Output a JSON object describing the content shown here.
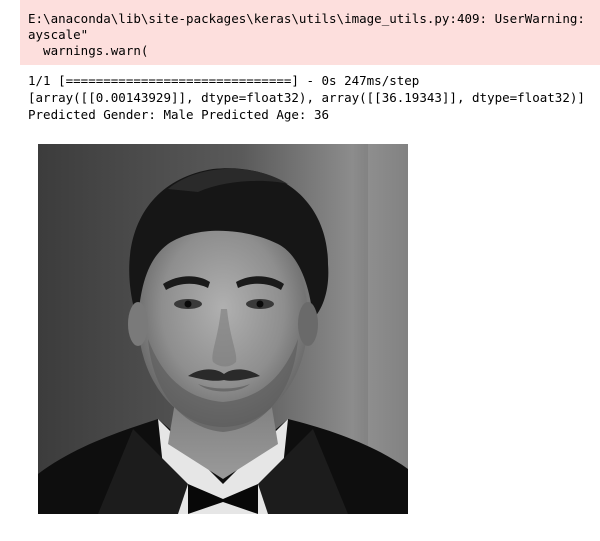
{
  "stderr": {
    "lines": [
      "E:\\anaconda\\lib\\site-packages\\keras\\utils\\image_utils.py:409: UserWarning: ",
      "ayscale\"",
      "  warnings.warn("
    ]
  },
  "stdout": {
    "lines": [
      "1/1 [==============================] - 0s 247ms/step",
      "[array([[0.00143929]], dtype=float32), array([[36.19343]], dtype=float32)]",
      "Predicted Gender: Male Predicted Age: 36"
    ]
  },
  "output_image": {
    "description_colors": {
      "background_left": "#3c3c3c",
      "background_right": "#8a8a8a",
      "skin": "#9a9a9a",
      "hair": "#1a1a1a",
      "suit": "#0d0d0d",
      "shirt": "#e8e8e8"
    }
  }
}
